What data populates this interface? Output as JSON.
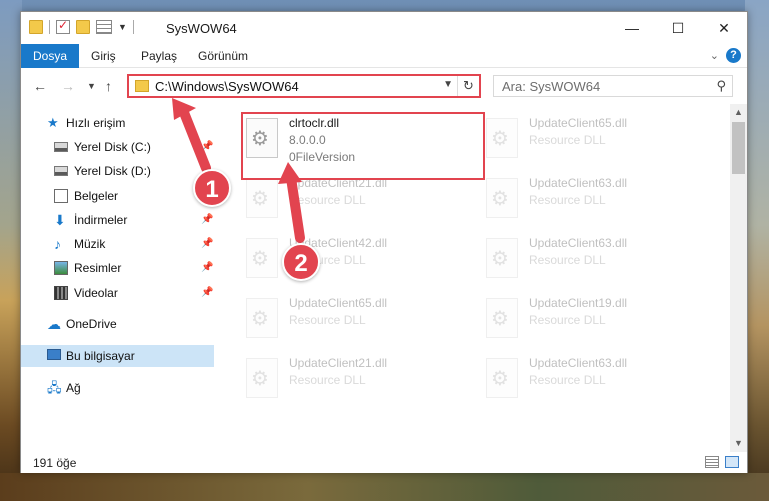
{
  "window": {
    "title": "SysWOW64"
  },
  "ribbon": {
    "tabs": [
      "Dosya",
      "Giriş",
      "Paylaş",
      "Görünüm"
    ],
    "active_tab": "Dosya",
    "help_label": "?"
  },
  "window_controls": {
    "minimize": "—",
    "maximize": "☐",
    "close": "✕"
  },
  "address": {
    "path": "C:\\Windows\\SysWOW64",
    "search_placeholder": "Ara: SysWOW64"
  },
  "nav": {
    "quick_access": "Hızlı erişim",
    "items": [
      "Yerel Disk (C:)",
      "Yerel Disk (D:)",
      "Belgeler",
      "İndirmeler",
      "Müzik",
      "Resimler",
      "Videolar"
    ],
    "onedrive": "OneDrive",
    "this_pc": "Bu bilgisayar",
    "network": "Ağ"
  },
  "files": {
    "highlighted": {
      "name": "clrtoclr.dll",
      "version": "8.0.0.0",
      "description": "0FileVersion"
    },
    "faded": [
      {
        "name": "UpdateClient65.dll",
        "type": "Resource DLL"
      },
      {
        "name": "UpdateClient21.dll",
        "type": "Resource DLL"
      },
      {
        "name": "UpdateClient63.dll",
        "type": "Resource DLL"
      },
      {
        "name": "UpdateClient42.dll",
        "type": "Resource DLL"
      },
      {
        "name": "UpdateClient63.dll",
        "type": "Resource DLL"
      },
      {
        "name": "UpdateClient65.dll",
        "type": "Resource DLL"
      },
      {
        "name": "UpdateClient19.dll",
        "type": "Resource DLL"
      },
      {
        "name": "UpdateClient21.dll",
        "type": "Resource DLL"
      },
      {
        "name": "UpdateClient63.dll",
        "type": "Resource DLL"
      }
    ]
  },
  "status": {
    "item_count": "191 öğe"
  },
  "annotations": {
    "step1": "1",
    "step2": "2",
    "color": "#e2444f"
  }
}
